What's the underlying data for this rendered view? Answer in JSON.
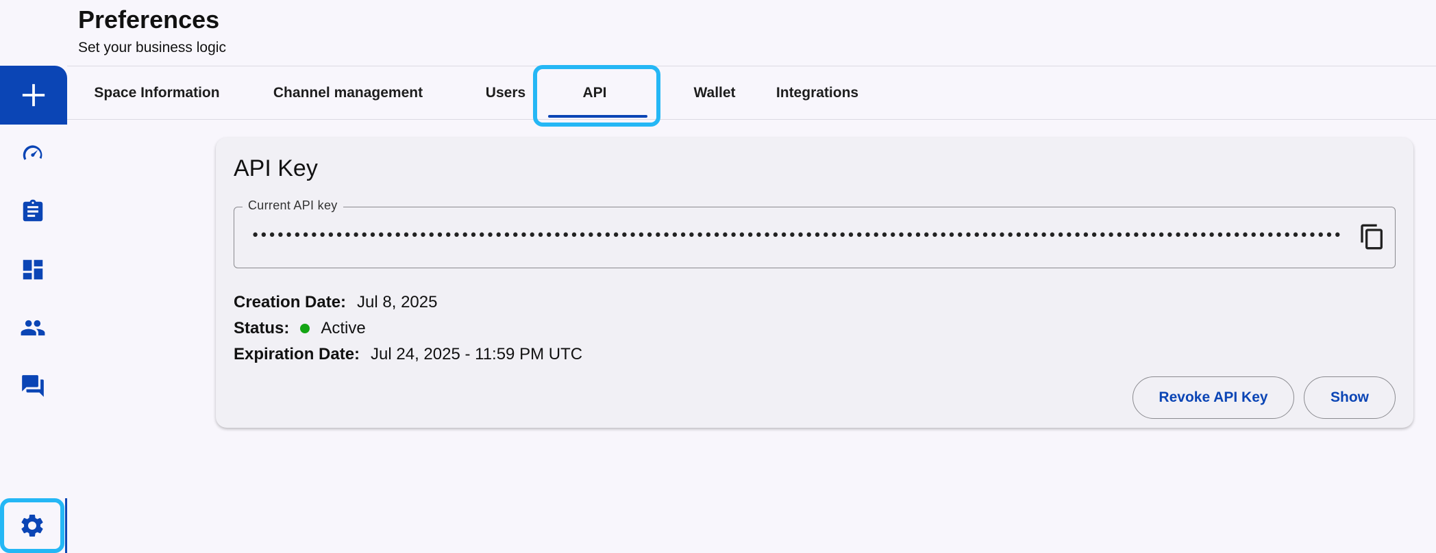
{
  "header": {
    "title": "Preferences",
    "subtitle": "Set your business logic"
  },
  "sidebar": {
    "new_button_icon": "plus-icon",
    "items": [
      {
        "icon": "speedometer-icon"
      },
      {
        "icon": "clipboard-icon"
      },
      {
        "icon": "dashboard-icon"
      },
      {
        "icon": "people-icon"
      },
      {
        "icon": "chat-icon"
      }
    ],
    "settings_icon": "gear-icon"
  },
  "tabs": [
    {
      "label": "Space Information"
    },
    {
      "label": "Channel management"
    },
    {
      "label": "Users"
    },
    {
      "label": "API",
      "selected": true
    },
    {
      "label": "Wallet"
    },
    {
      "label": "Integrations"
    }
  ],
  "api_key": {
    "title": "API Key",
    "field_label": "Current API key",
    "masked_value": "••••••••••••••••••••••••••••••••••••••••••••••••••••••••••••••••••••••••••••••••••••••••••••••••••••••••••••••••••••••••••••••••••••••••••••••••••••••••••••••••",
    "copy_icon": "copy-icon",
    "creation_label": "Creation Date:",
    "creation_value": "Jul 8, 2025",
    "status_label": "Status:",
    "status_value": "Active",
    "expiration_label": "Expiration Date:",
    "expiration_value": "Jul 24, 2025 - 11:59 PM UTC",
    "revoke_label": "Revoke API Key",
    "show_label": "Show"
  },
  "colors": {
    "accent": "#0b45b5",
    "highlight": "#25b7f5",
    "status_active": "#14a514"
  }
}
